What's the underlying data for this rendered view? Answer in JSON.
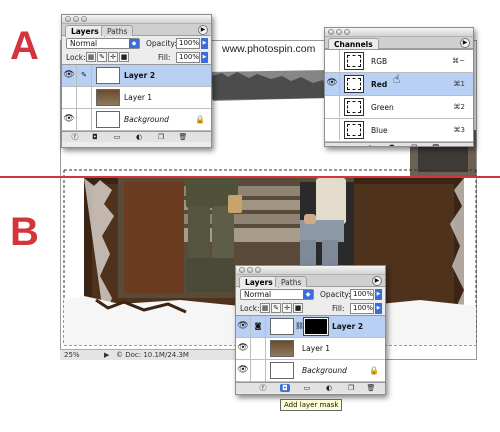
{
  "labels": {
    "step_a": "A",
    "step_b": "B"
  },
  "document": {
    "url_text": "www.photospin.com",
    "zoom": "25%",
    "info": "© Doc: 10.1M/24.3M",
    "status_arrow": "▶"
  },
  "layers_palette_a": {
    "tabs": [
      "Layers",
      "Paths"
    ],
    "blend_mode": "Normal",
    "opacity_label": "Opacity:",
    "opacity_value": "100%",
    "lock_label": "Lock:",
    "fill_label": "Fill:",
    "fill_value": "100%",
    "layers": [
      {
        "name": "Layer 2",
        "selected": true
      },
      {
        "name": "Layer 1",
        "selected": false
      },
      {
        "name": "Background",
        "selected": false
      }
    ]
  },
  "channels_palette": {
    "tabs": [
      "Channels"
    ],
    "channels": [
      {
        "name": "RGB",
        "shortcut": "⌘~"
      },
      {
        "name": "Red",
        "shortcut": "⌘1",
        "selected": true
      },
      {
        "name": "Green",
        "shortcut": "⌘2"
      },
      {
        "name": "Blue",
        "shortcut": "⌘3"
      }
    ]
  },
  "layers_palette_b": {
    "tabs": [
      "Layers",
      "Paths"
    ],
    "blend_mode": "Normal",
    "opacity_label": "Opacity:",
    "opacity_value": "100%",
    "lock_label": "Lock:",
    "fill_label": "Fill:",
    "fill_value": "100%",
    "layers": [
      {
        "name": "Layer 2",
        "selected": true
      },
      {
        "name": "Layer 1",
        "selected": false
      },
      {
        "name": "Background",
        "selected": false
      }
    ]
  },
  "tooltip": "Add layer mask",
  "colors": {
    "accent_red": "#d2353c",
    "selection_blue": "#b7d0f3",
    "stepper_blue": "#3b6ed8"
  }
}
